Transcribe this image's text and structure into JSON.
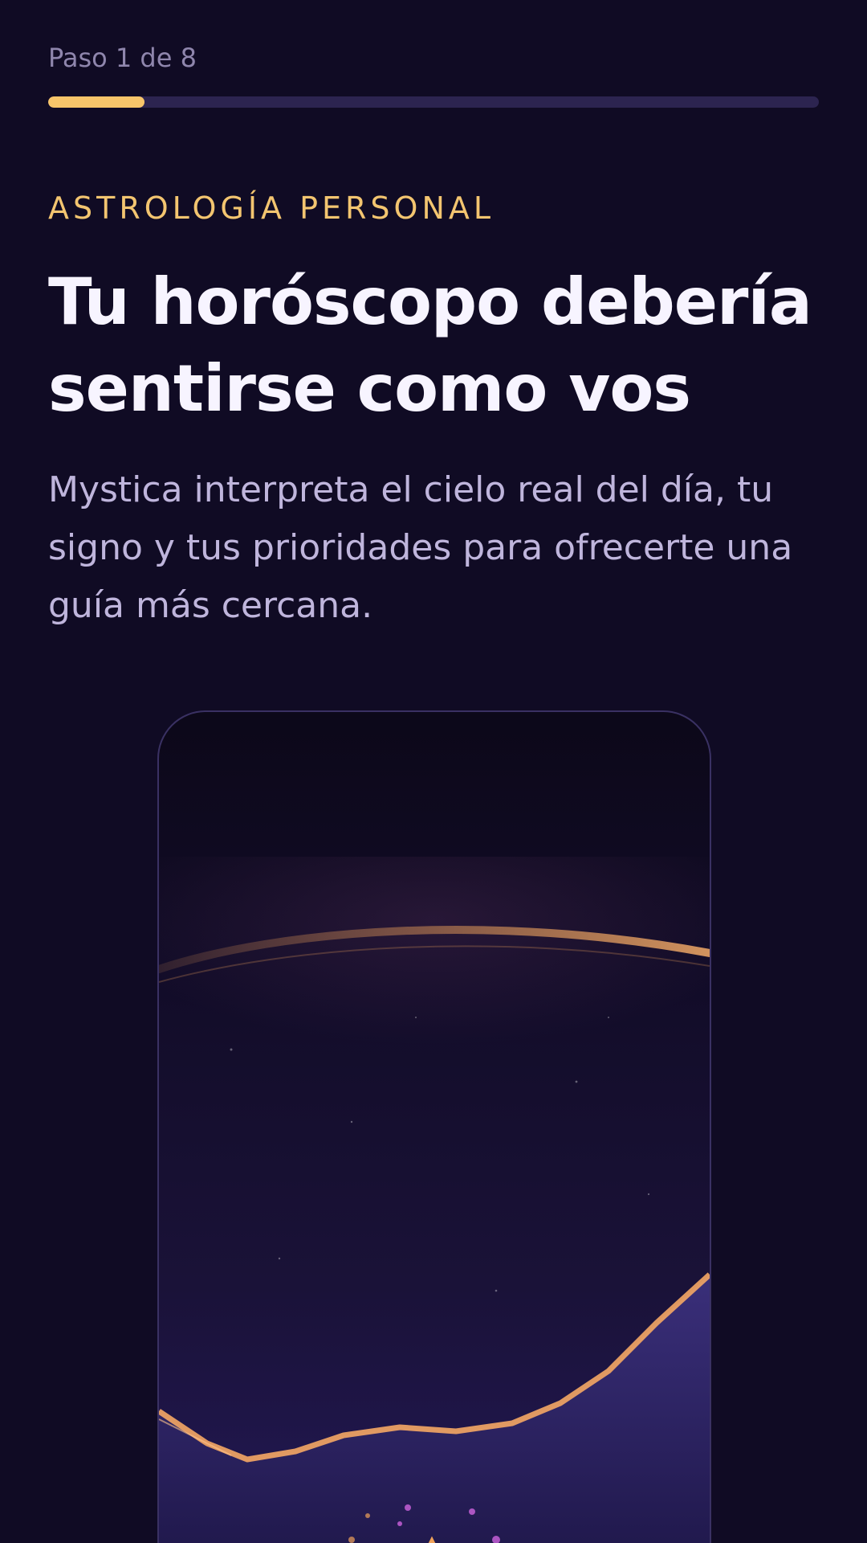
{
  "progress": {
    "step_text": "Paso 1 de 8",
    "current_step": 1,
    "total_steps": 8,
    "fill_fraction": 0.125,
    "track_color": "#2c2450",
    "fill_color": "#f7c56a"
  },
  "intro": {
    "eyebrow": "ASTROLOGÍA PERSONAL",
    "eyebrow_color": "#f3c570",
    "title": "Tu horóscopo debería sentirse como vos",
    "description": "Mystica interpreta el cielo real del día, tu signo y tus prioridades para ofrecerte una guía más cercana."
  },
  "illustration": {
    "icon": "mystic-cat-illustration",
    "accent_color": "#f0a25a",
    "glow_color": "#c45fd6"
  }
}
